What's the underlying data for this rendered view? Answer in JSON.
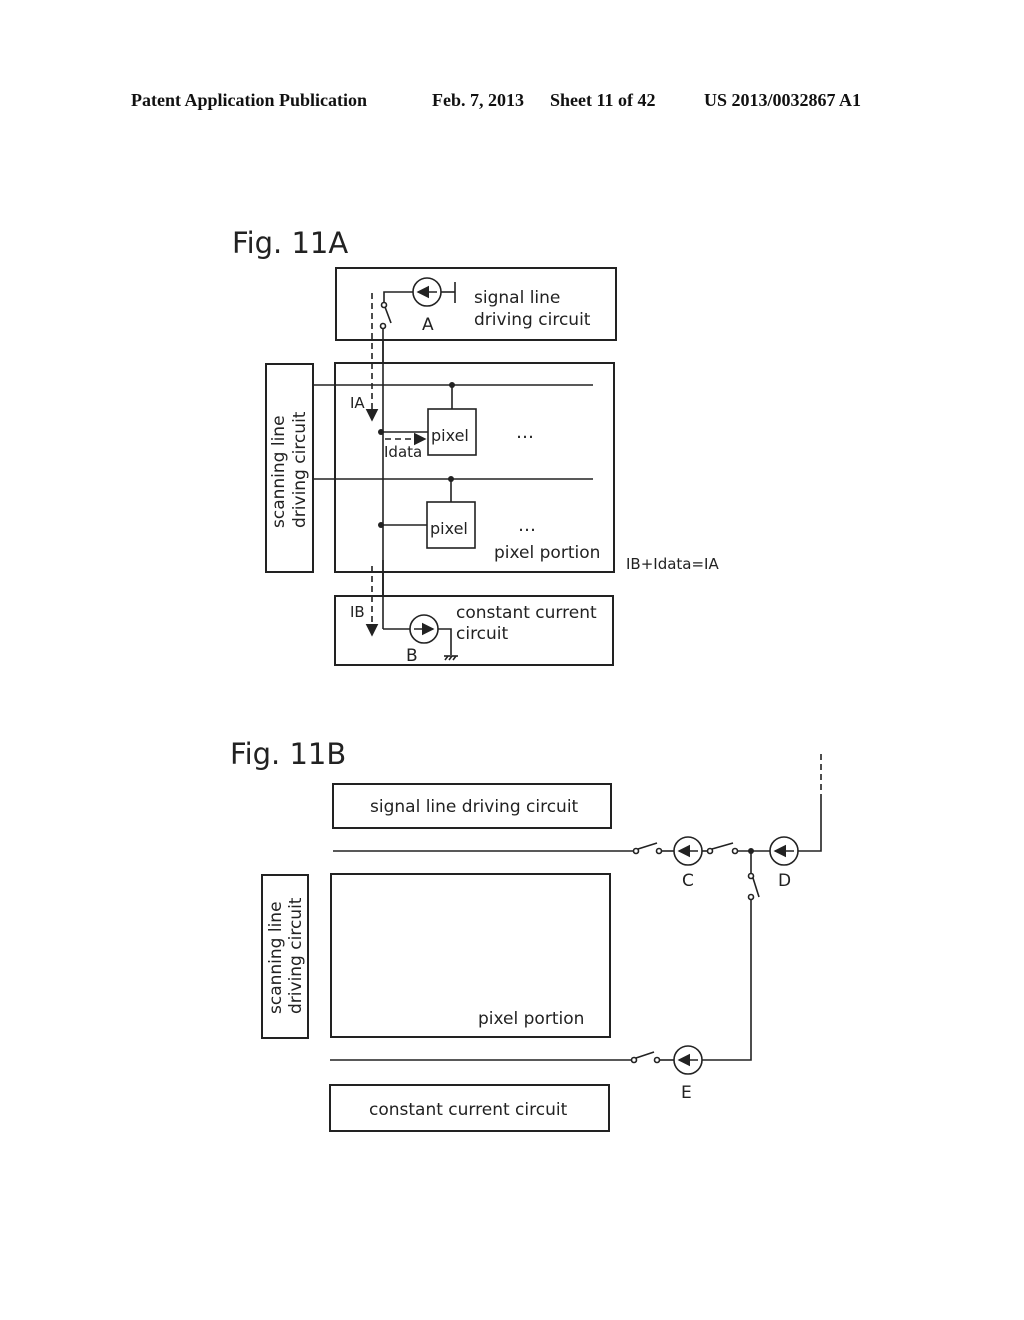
{
  "header": {
    "publication": "Patent Application Publication",
    "date": "Feb. 7, 2013",
    "sheet": "Sheet 11 of 42",
    "number": "US 2013/0032867 A1"
  },
  "fig11a": {
    "title": "Fig. 11A",
    "signal_line_label_1": "signal line",
    "signal_line_label_2": "driving circuit",
    "source_a": "A",
    "scanning_label_1": "scanning line",
    "scanning_label_2": "driving circuit",
    "pixel_1": "pixel",
    "pixel_2": "pixel",
    "ellipsis": "…",
    "pixel_portion": "pixel portion",
    "current_ia": "IA",
    "current_idata": "Idata",
    "current_ib": "IB",
    "equation": "IB+Idata=IA",
    "constant_label_1": "constant current",
    "constant_label_2": "circuit",
    "source_b": "B"
  },
  "fig11b": {
    "title": "Fig. 11B",
    "signal_line": "signal line driving circuit",
    "scanning_label_1": "scanning line",
    "scanning_label_2": "driving circuit",
    "pixel_portion": "pixel portion",
    "constant_current": "constant current circuit",
    "source_c": "C",
    "source_d": "D",
    "source_e": "E"
  }
}
